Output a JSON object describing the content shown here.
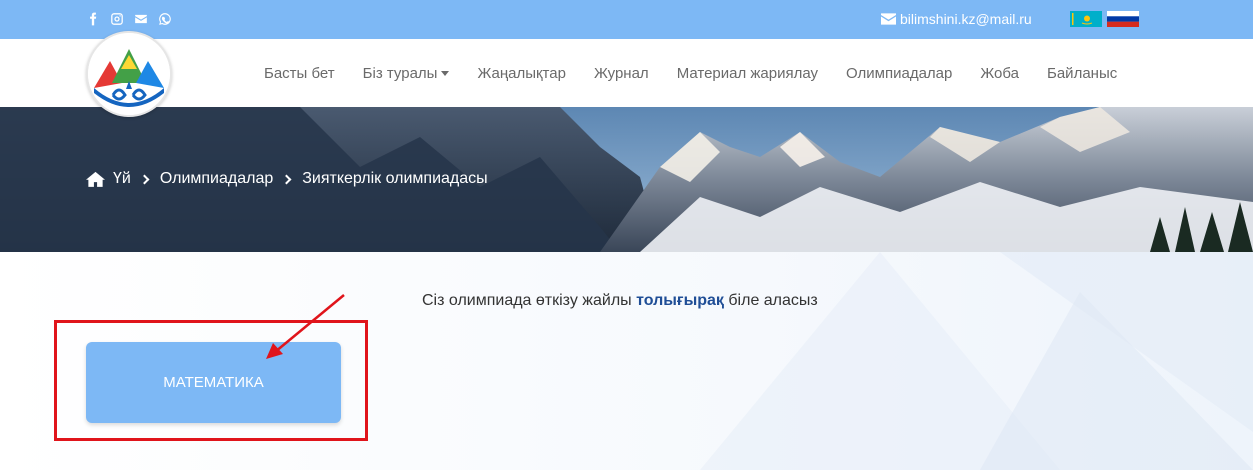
{
  "topbar": {
    "social_icons": [
      "facebook-icon",
      "instagram-icon",
      "envelope-icon",
      "whatsapp-icon"
    ],
    "email": "bilimshini.kz@mail.ru",
    "languages": [
      "kazakh-flag",
      "russian-flag"
    ]
  },
  "nav": {
    "items": [
      "Басты бет",
      "Біз туралы",
      "Жаңалықтар",
      "Журнал",
      "Материал жариялау",
      "Олимпиадалар",
      "Жоба",
      "Байланыс"
    ]
  },
  "breadcrumb": {
    "home": "Үй",
    "level1": "Олимпиадалар",
    "level2": "Зияткерлік олимпиадасы"
  },
  "content": {
    "info_before": "Сіз олимпиада өткізу жайлы ",
    "info_link": "толығырақ",
    "info_after": " біле аласыз",
    "subject_button": "МАТЕМАТИКА"
  },
  "colors": {
    "accent": "#7db8f5",
    "link": "#1f4e96",
    "highlight": "#e0141b"
  }
}
